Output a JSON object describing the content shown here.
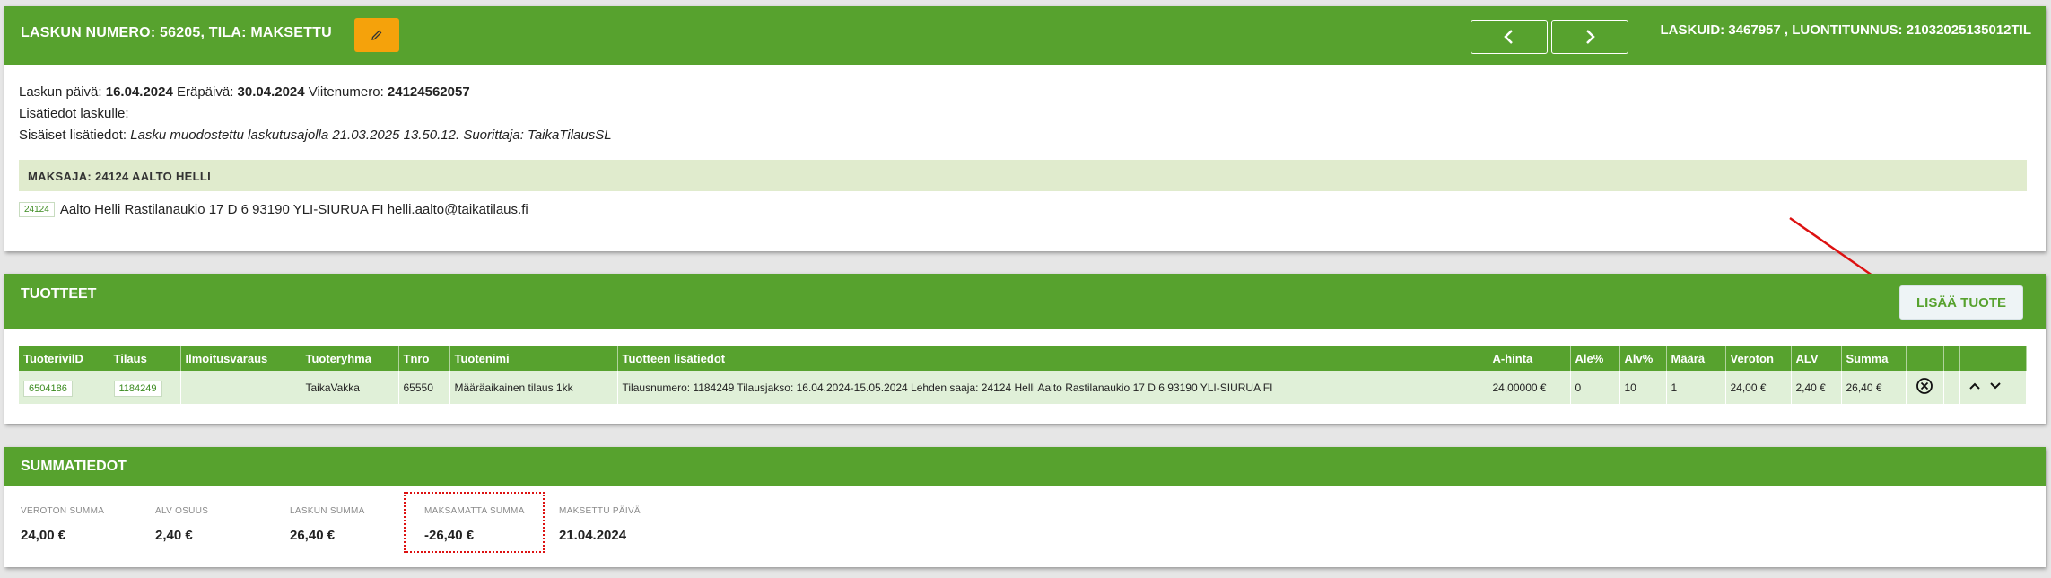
{
  "invoice": {
    "title_prefix": "LASKUN NUMERO:",
    "number": "56205",
    "state_label": ", TILA:",
    "state": "MAKSETTU",
    "ids": "LASKUID: 3467957 , LUONTITUNNUS: 21032025135012TIL",
    "date_label": "Laskun päivä:",
    "date": "16.04.2024",
    "due_label": "Eräpäivä:",
    "due": "30.04.2024",
    "ref_label": "Viitenumero:",
    "ref": "24124562057",
    "extra_label": "Lisätiedot laskulle:",
    "internal_label": "Sisäiset lisätiedot:",
    "internal_text": "Lasku muodostettu laskutusajolla 21.03.2025 13.50.12. Suorittaja: TaikaTilausSL",
    "payer_label": "MAKSAJA:",
    "payer": "24124 AALTO HELLI",
    "payer_tag": "24124",
    "payer_address": "Aalto Helli Rastilanaukio 17 D 6 93190 YLI-SIURUA FI helli.aalto@taikatilaus.fi"
  },
  "products": {
    "title": "TUOTTEET",
    "add_button": "LISÄÄ TUOTE",
    "columns": [
      "TuoterivilD",
      "Tilaus",
      "Ilmoitusvaraus",
      "Tuoteryhma",
      "Tnro",
      "Tuotenimi",
      "Tuotteen lisätiedot",
      "A-hinta",
      "Ale%",
      "Alv%",
      "Määrä",
      "Veroton",
      "ALV",
      "Summa",
      "",
      "",
      ""
    ],
    "row": {
      "row_id": "6504186",
      "order": "1184249",
      "reservation": "",
      "group": "TaikaVakka",
      "tnro": "65550",
      "name": "Määräaikainen tilaus 1kk",
      "details": "Tilausnumero: 1184249 Tilausjakso: 16.04.2024-15.05.2024 Lehden saaja: 24124 Helli Aalto Rastilanaukio 17 D 6 93190 YLI-SIURUA FI",
      "unit_price": "24,00000 €",
      "discount": "0",
      "vat_pct": "10",
      "qty": "1",
      "net": "24,00 €",
      "vat": "2,40 €",
      "total": "26,40 €"
    }
  },
  "sums": {
    "title": "SUMMATIEDOT",
    "items": [
      {
        "label": "VEROTON SUMMA",
        "value": "24,00 €"
      },
      {
        "label": "ALV OSUUS",
        "value": "2,40 €"
      },
      {
        "label": "LASKUN SUMMA",
        "value": "26,40 €"
      },
      {
        "label": "MAKSAMATTA SUMMA",
        "value": "-26,40 €"
      },
      {
        "label": "MAKSETTU PÄIVÄ",
        "value": "21.04.2024"
      }
    ]
  },
  "colors": {
    "brand_green": "#57a22e",
    "edit_orange": "#f5a20b",
    "annotation_red": "#dd1111"
  },
  "icons": [
    "edit-icon",
    "chevron-left-icon",
    "chevron-right-icon",
    "remove-circle-icon",
    "chevron-up-icon",
    "chevron-down-icon"
  ]
}
